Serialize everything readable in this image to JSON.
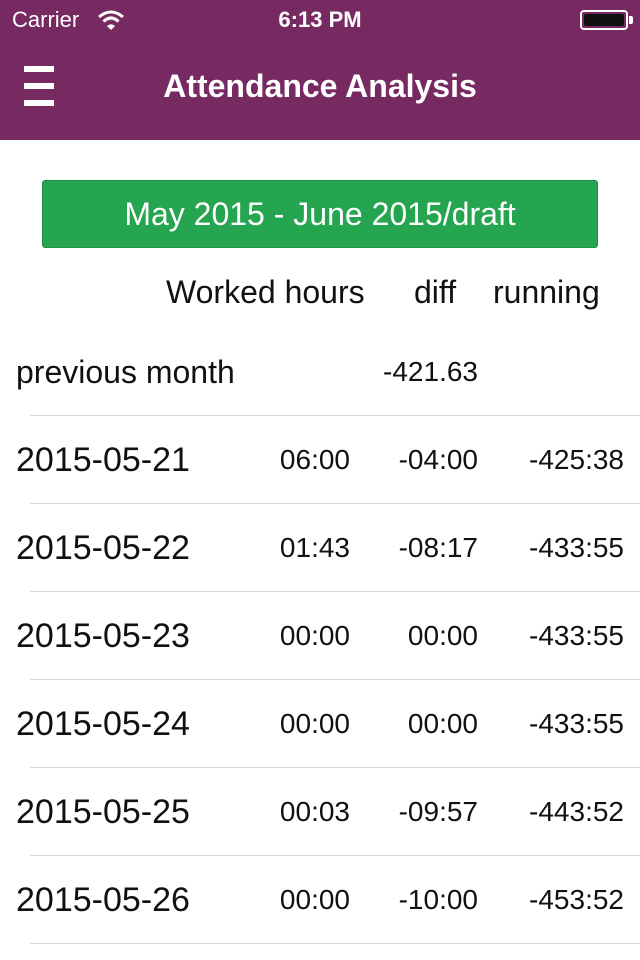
{
  "status_bar": {
    "carrier": "Carrier",
    "time": "6:13 PM"
  },
  "nav": {
    "title": "Attendance Analysis"
  },
  "period_button": {
    "label": "May 2015 - June 2015/draft"
  },
  "columns": {
    "worked": "Worked hours",
    "diff": "diff",
    "running": "running"
  },
  "previous_month": {
    "label": "previous month",
    "value": "-421.63"
  },
  "rows": [
    {
      "date": "2015-05-21",
      "worked": "06:00",
      "diff": "-04:00",
      "running": "-425:38"
    },
    {
      "date": "2015-05-22",
      "worked": "01:43",
      "diff": "-08:17",
      "running": "-433:55"
    },
    {
      "date": "2015-05-23",
      "worked": "00:00",
      "diff": "00:00",
      "running": "-433:55"
    },
    {
      "date": "2015-05-24",
      "worked": "00:00",
      "diff": "00:00",
      "running": "-433:55"
    },
    {
      "date": "2015-05-25",
      "worked": "00:03",
      "diff": "-09:57",
      "running": "-443:52"
    },
    {
      "date": "2015-05-26",
      "worked": "00:00",
      "diff": "-10:00",
      "running": "-453:52"
    }
  ],
  "colors": {
    "header_bg": "#772a61",
    "button_bg": "#25a550"
  },
  "icons": {
    "menu": "hamburger-menu-icon",
    "wifi": "wifi-icon",
    "battery": "battery-icon"
  }
}
